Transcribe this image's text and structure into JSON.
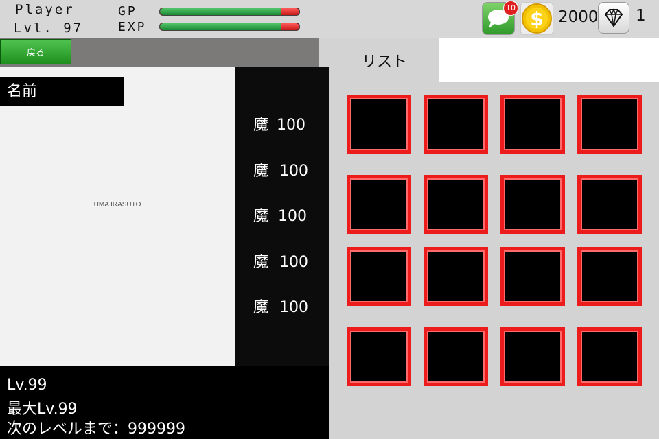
{
  "hud": {
    "player_label": "Player",
    "level_label": "Lvl. 97",
    "gp_label": "GP",
    "exp_label": "EXP",
    "gp_fill": 0.87,
    "exp_fill": 0.87,
    "message_badge": "10",
    "coins": "2000",
    "gems": "1"
  },
  "left": {
    "back_button": "戻る",
    "name_label": "名前",
    "portrait_label": "UMA IRASUTO",
    "stats": [
      {
        "label": "魔",
        "value": "100"
      },
      {
        "label": "魔",
        "value": "100"
      },
      {
        "label": "魔",
        "value": "100"
      },
      {
        "label": "魔",
        "value": "100"
      },
      {
        "label": "魔",
        "value": "100"
      }
    ],
    "info": {
      "level": "Lv.99",
      "max_level": "最大Lv.99",
      "next_level": "次のレベルまで：999999"
    }
  },
  "right": {
    "tab_label": "リスト",
    "slot_count": 16
  },
  "colors": {
    "slot_border": "#ec1c1c",
    "gp_bar": "#2fa84a",
    "back_button": "#2ea52e"
  }
}
